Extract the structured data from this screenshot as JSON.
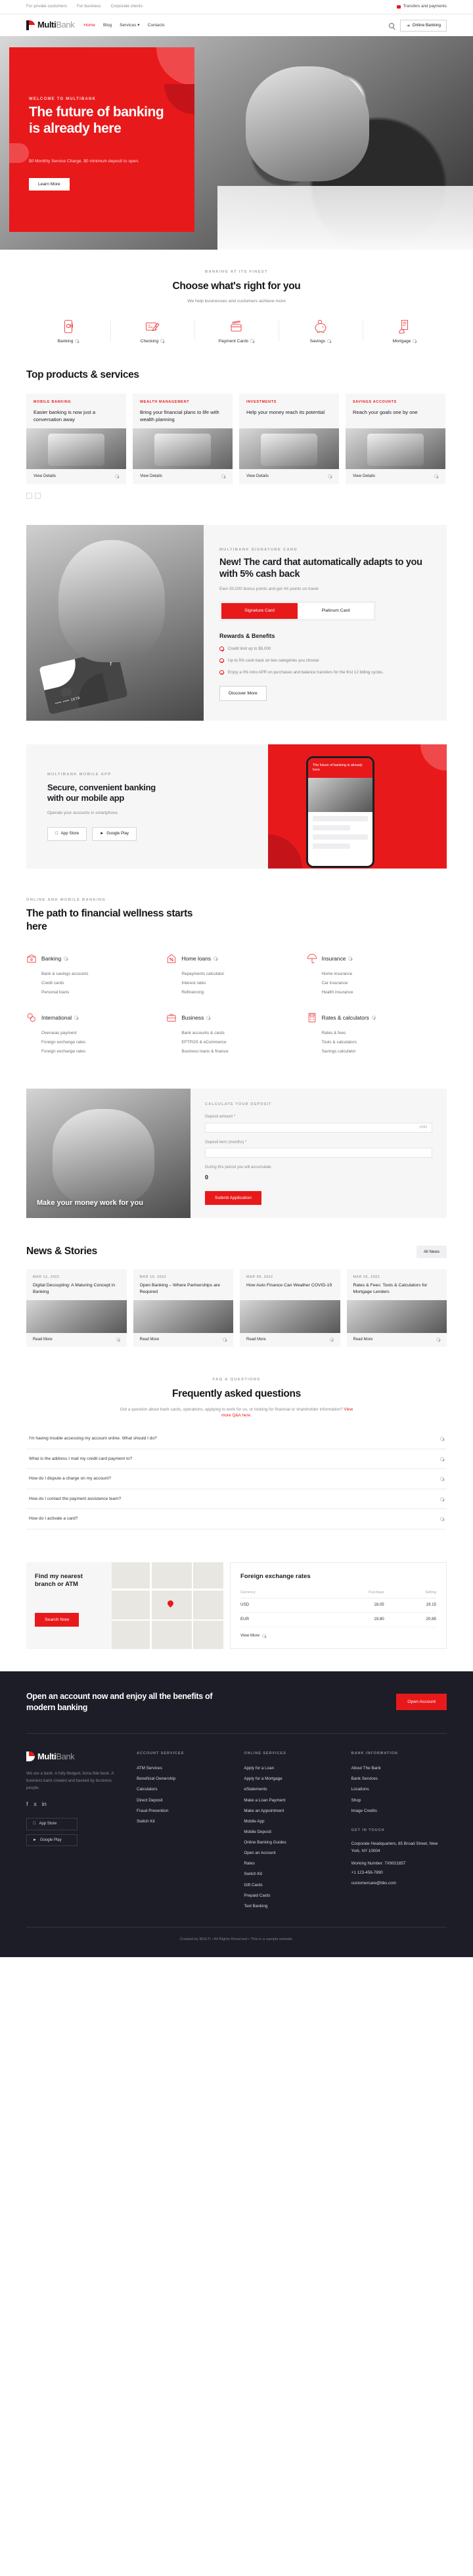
{
  "utility": {
    "links": [
      "For private customers",
      "For business",
      "Corporate clients"
    ],
    "transfers_label": "Transfers and payments"
  },
  "nav": {
    "brand_left": "Multi",
    "brand_right": "Bank",
    "links": [
      {
        "label": "Home",
        "active": true
      },
      {
        "label": "Blog",
        "active": false
      },
      {
        "label": "Services ▾",
        "active": false
      },
      {
        "label": "Contacts",
        "active": false
      }
    ],
    "online_banking": "Online Banking",
    "search_icon": "search-icon",
    "login_icon": "login-icon"
  },
  "hero": {
    "eyebrow": "WELCOME TO MULTIBANK",
    "title": "The future of banking is already here",
    "subtitle": "$0 Monthly Service Charge. $0 minimum deposit to open.",
    "cta": "Learn More"
  },
  "choose": {
    "eyebrow": "BANKING AT ITS FINEST",
    "title": "Choose what's right for you",
    "lead": "We help businesses and customers achieve more",
    "categories": [
      {
        "label": "Banking",
        "icon": "mobile-banking-icon"
      },
      {
        "label": "Checking",
        "icon": "cheque-icon"
      },
      {
        "label": "Payment Cards",
        "icon": "cards-icon"
      },
      {
        "label": "Savings",
        "icon": "piggy-bank-icon"
      },
      {
        "label": "Mortgage",
        "icon": "document-house-icon"
      }
    ]
  },
  "top_products": {
    "title": "Top products & services",
    "view_details": "View Details",
    "items": [
      {
        "tag": "MOBILE BANKING",
        "title": "Easier banking is now just a conversation away"
      },
      {
        "tag": "WEALTH MANAGEMENT",
        "title": "Bring your financial plans to life with wealth planning"
      },
      {
        "tag": "INVESTMENTS",
        "title": "Help your money reach its potential"
      },
      {
        "tag": "SAVINGS ACCOUNTS",
        "title": "Reach your goals one by one"
      }
    ]
  },
  "card_promo": {
    "eyebrow": "MULTIBANK SIGNATURE CARD",
    "title": "New! The card that automatically adapts to you with 5% cash back",
    "subtitle": "Earn 50,000 bonus points and get 4X points on travel",
    "tabs": [
      {
        "label": "Signature Card",
        "active": true
      },
      {
        "label": "Platinum Card",
        "active": false
      }
    ],
    "rewards_title": "Rewards & Benefits",
    "rewards": [
      "Credit limit up to $5,000",
      "Up to 5% cash back on two categories you choose",
      "Enjoy a 0% intro APR on purchases and balance transfers for the first 12 billing cycles."
    ],
    "cta": "Discover More",
    "card_number": "••••  ••••  1678"
  },
  "app": {
    "eyebrow": "MULTIBANK MOBILE APP",
    "title": "Secure, convenient banking with our mobile app",
    "subtitle": "Operate your accounts in smartphone",
    "stores": [
      {
        "label": "App Store",
        "icon": "apple-icon"
      },
      {
        "label": "Google Play",
        "icon": "google-play-icon"
      }
    ],
    "phone_headline": "The future of banking is already here"
  },
  "wellness": {
    "eyebrow": "ONLINE AND MOBILE BANKING",
    "title": "The path to financial wellness starts here",
    "columns": [
      {
        "title": "Banking",
        "icon": "wallet-icon",
        "links": [
          "Bank & savings accounts",
          "Credit cards",
          "Personal loans"
        ]
      },
      {
        "title": "Home loans",
        "icon": "house-percent-icon",
        "links": [
          "Repayments calculator",
          "Interest rates",
          "Refinancing"
        ]
      },
      {
        "title": "Insurance",
        "icon": "umbrella-icon",
        "links": [
          "Home insurance",
          "Car insurance",
          "Health insurance"
        ]
      },
      {
        "title": "International",
        "icon": "currency-coins-icon",
        "links": [
          "Overseas payment",
          "Foreign exchange rates",
          "Foreign exchange rates"
        ]
      },
      {
        "title": "Business",
        "icon": "briefcase-icon",
        "links": [
          "Bank accounts & cards",
          "EFTPOS & eCommerce",
          "Business loans & finance"
        ]
      },
      {
        "title": "Rates & calculators",
        "icon": "calculator-icon",
        "links": [
          "Rates & fees",
          "Tools & calculators",
          "Savings calculator"
        ]
      }
    ]
  },
  "calculator": {
    "eyebrow": "CALCULATE YOUR DEPOSIT",
    "caption": "Make your money work for you",
    "fields": [
      {
        "label": "Deposit amount *",
        "value": "",
        "unit": "USD"
      },
      {
        "label": "Deposit term (months) *",
        "value": "",
        "unit": ""
      }
    ],
    "result_label": "During this period you will accumulate",
    "result_value": "0",
    "submit": "Submit Application"
  },
  "news": {
    "title": "News & Stories",
    "filter": "All News",
    "read_more": "Read More",
    "items": [
      {
        "date": "MAR 12, 2022",
        "title": "Digital Decoupling: A Maturing Concept in Banking"
      },
      {
        "date": "MAR 10, 2022",
        "title": "Open Banking – Where Partnerships are Required"
      },
      {
        "date": "MAR 08, 2022",
        "title": "How Auto Finance Can Weather COVID-19"
      },
      {
        "date": "MAR 05, 2022",
        "title": "Rates & Fees: Tools & Calculators for Mortgage Lenders"
      }
    ]
  },
  "faq": {
    "eyebrow": "FAQ & QUESTIONS",
    "title": "Frequently asked questions",
    "subtitle_pre": "Got a question about bank cards, operations, applying to work for us, or looking for financial or shareholder information? ",
    "subtitle_link": "View more Q&A here.",
    "questions": [
      "I'm having trouble accessing my account online. What should I do?",
      "What is the address I mail my credit card payment to?",
      "How do I dispute a charge on my account?",
      "How do I contact the payment assistance team?",
      "How do I activate a card?"
    ]
  },
  "branch": {
    "title": "Find my nearest branch or ATM",
    "cta": "Search Now",
    "map_pin": "map-pin-icon"
  },
  "fx": {
    "title": "Foreign exchange rates",
    "headers": [
      "Currency",
      "Purchase",
      "Selling"
    ],
    "rows": [
      {
        "currency": "USD",
        "purchase": "18.05",
        "selling": "19.15"
      },
      {
        "currency": "EUR",
        "purchase": "19.80",
        "selling": "20.85"
      }
    ],
    "view_more": "View More"
  },
  "cta_band": {
    "title": "Open an account now and enjoy all the benefits of modern banking",
    "button": "Open Account"
  },
  "footer": {
    "brand_left": "Multi",
    "brand_right": "Bank",
    "about": "We are a bank. A fully-fledged, bona fide bank. A business bank created and backed by business people.",
    "social": [
      "facebook-icon",
      "twitter-icon",
      "linkedin-icon"
    ],
    "stores": [
      {
        "label": "App Store",
        "icon": "apple-icon"
      },
      {
        "label": "Google Play",
        "icon": "google-play-icon"
      }
    ],
    "columns": [
      {
        "heading": "ACCOUNT SERVICES",
        "links": [
          "ATM Services",
          "Beneficial Ownership",
          "Calculators",
          "Direct Deposit",
          "Fraud Prevention",
          "Switch Kit"
        ]
      },
      {
        "heading": "ONLINE SERVICES",
        "links": [
          "Apply for a Loan",
          "Apply for a Mortgage",
          "eStatements",
          "Make a Loan Payment",
          "Make an Appointment",
          "Mobile App",
          "Mobile Deposit",
          "Online Banking Guides",
          "Open an Account",
          "Rates",
          "Switch Kit",
          "Gift Cards",
          "Prepaid Cards",
          "Text Banking"
        ]
      },
      {
        "heading": "BANK INFORMATION",
        "links": [
          "About The Bank",
          "Bank Services",
          "Locations",
          "Shop",
          "Image Credits"
        ]
      }
    ],
    "contact_heading": "GET IN TOUCH",
    "contact_address": "Corporate Headquarters, 85 Broad Street, New York, NY 10004",
    "contact_hours": "Working Number: 7X9021857",
    "contact_phone": "+1 123-456-7890",
    "contact_email": "customercare@bbs.com",
    "copyright": "Created by MULTI • All Rights Reserved • This is a sample website."
  }
}
